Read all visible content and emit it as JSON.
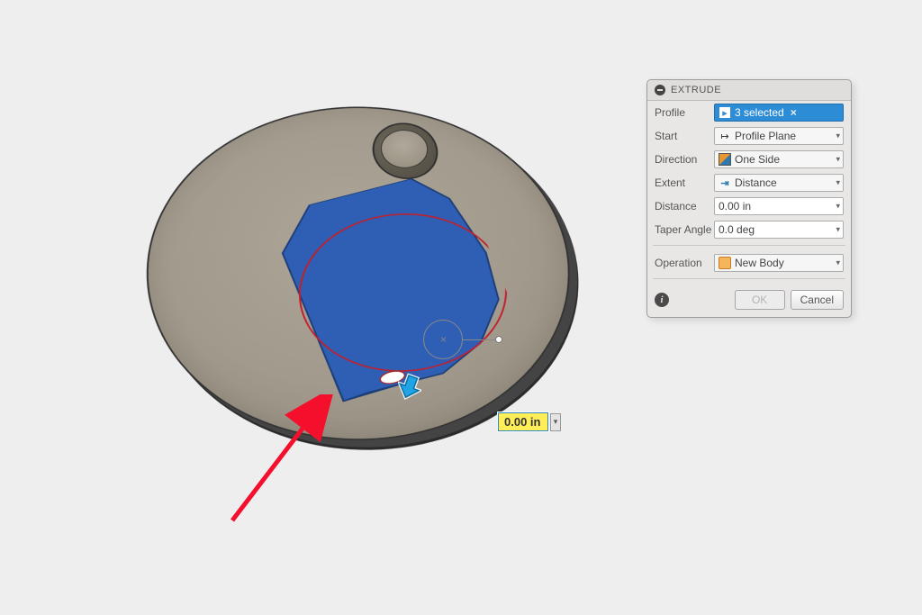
{
  "panel": {
    "title": "EXTRUDE",
    "rows": {
      "profile": {
        "label": "Profile",
        "value": "3 selected",
        "clear": "×"
      },
      "start": {
        "label": "Start",
        "value": "Profile Plane"
      },
      "direction": {
        "label": "Direction",
        "value": "One Side"
      },
      "extent": {
        "label": "Extent",
        "value": "Distance"
      },
      "distance": {
        "label": "Distance",
        "value": "0.00 in"
      },
      "taper": {
        "label": "Taper Angle",
        "value": "0.0 deg"
      },
      "operation": {
        "label": "Operation",
        "value": "New Body"
      }
    },
    "buttons": {
      "ok": "OK",
      "cancel": "Cancel"
    },
    "info": "i"
  },
  "viewport": {
    "inline_value": "0.00 in"
  },
  "colors": {
    "accent_blue": "#2d8cd6",
    "profile_fill": "#2f5fb4",
    "annotation_arrow": "#f40f2d",
    "highlight_yellow": "#ffee58"
  }
}
